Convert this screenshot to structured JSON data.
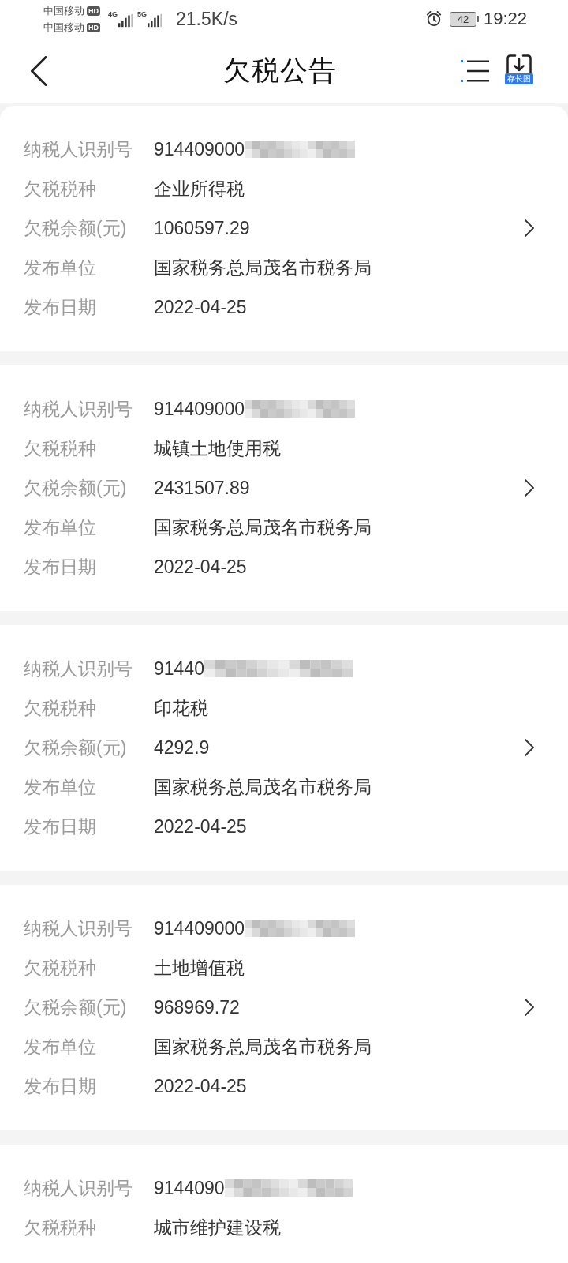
{
  "status_bar": {
    "carriers": [
      {
        "name": "中国移动",
        "badge": "HD"
      },
      {
        "name": "中国移动",
        "badge": "HD"
      }
    ],
    "networks": [
      {
        "type": "4G"
      },
      {
        "type": "5G"
      }
    ],
    "speed": "21.5K/s",
    "battery": "42",
    "time": "19:22"
  },
  "header": {
    "title": "欠税公告",
    "save_badge": "存长图"
  },
  "notices": [
    {
      "fields": [
        {
          "label": "纳税人识别号",
          "value": "914409000",
          "masked": true
        },
        {
          "label": "欠税税种",
          "value": "企业所得税",
          "masked": false
        },
        {
          "label": "欠税余额(元)",
          "value": "1060597.29",
          "masked": false
        },
        {
          "label": "发布单位",
          "value": "国家税务总局茂名市税务局",
          "masked": false
        },
        {
          "label": "发布日期",
          "value": "2022-04-25",
          "masked": false
        }
      ]
    },
    {
      "fields": [
        {
          "label": "纳税人识别号",
          "value": "914409000",
          "masked": true
        },
        {
          "label": "欠税税种",
          "value": "城镇土地使用税",
          "masked": false
        },
        {
          "label": "欠税余额(元)",
          "value": "2431507.89",
          "masked": false
        },
        {
          "label": "发布单位",
          "value": "国家税务总局茂名市税务局",
          "masked": false
        },
        {
          "label": "发布日期",
          "value": "2022-04-25",
          "masked": false
        }
      ]
    },
    {
      "fields": [
        {
          "label": "纳税人识别号",
          "value": "91440",
          "masked": true
        },
        {
          "label": "欠税税种",
          "value": "印花税",
          "masked": false
        },
        {
          "label": "欠税余额(元)",
          "value": "4292.9",
          "masked": false
        },
        {
          "label": "发布单位",
          "value": "国家税务总局茂名市税务局",
          "masked": false
        },
        {
          "label": "发布日期",
          "value": "2022-04-25",
          "masked": false
        }
      ]
    },
    {
      "fields": [
        {
          "label": "纳税人识别号",
          "value": "914409000",
          "masked": true
        },
        {
          "label": "欠税税种",
          "value": "土地增值税",
          "masked": false
        },
        {
          "label": "欠税余额(元)",
          "value": "968969.72",
          "masked": false
        },
        {
          "label": "发布单位",
          "value": "国家税务总局茂名市税务局",
          "masked": false
        },
        {
          "label": "发布日期",
          "value": "2022-04-25",
          "masked": false
        }
      ]
    },
    {
      "fields": [
        {
          "label": "纳税人识别号",
          "value": "9144090",
          "masked": true
        },
        {
          "label": "欠税税种",
          "value": "城市维护建设税",
          "masked": false
        }
      ]
    }
  ]
}
